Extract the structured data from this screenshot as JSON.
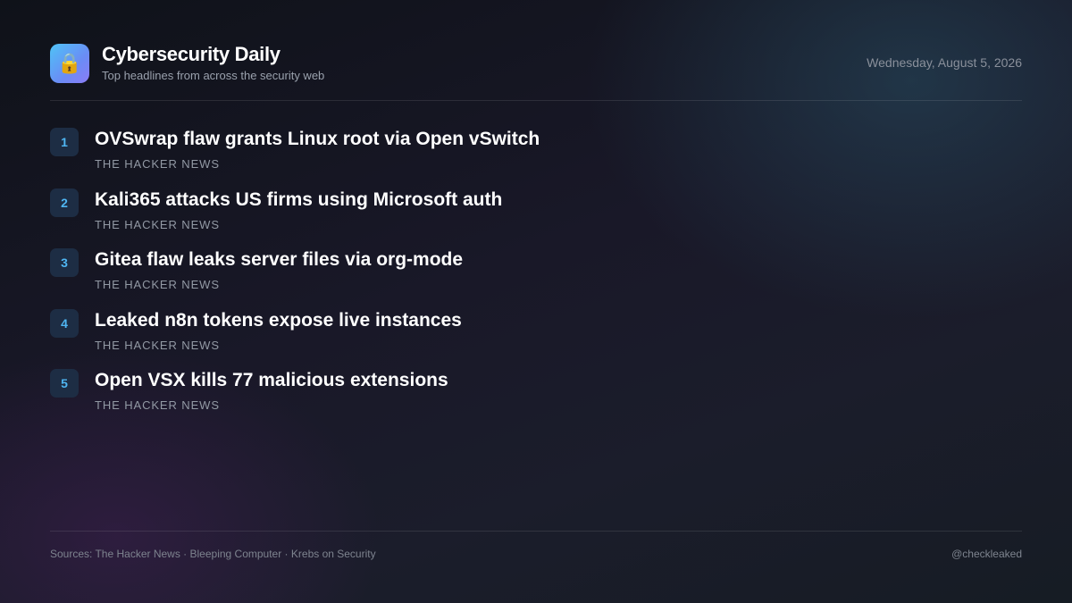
{
  "header": {
    "logo_icon": "🔒",
    "title": "Cybersecurity Daily",
    "subtitle": "Top headlines from across the security web",
    "date": "Wednesday, August 5, 2026"
  },
  "headlines": [
    {
      "rank": "1",
      "title": "OVSwrap flaw grants Linux root via Open vSwitch",
      "source": "THE HACKER NEWS"
    },
    {
      "rank": "2",
      "title": "Kali365 attacks US firms using Microsoft auth",
      "source": "THE HACKER NEWS"
    },
    {
      "rank": "3",
      "title": "Gitea flaw leaks server files via org-mode",
      "source": "THE HACKER NEWS"
    },
    {
      "rank": "4",
      "title": "Leaked n8n tokens expose live instances",
      "source": "THE HACKER NEWS"
    },
    {
      "rank": "5",
      "title": "Open VSX kills 77 malicious extensions",
      "source": "THE HACKER NEWS"
    }
  ],
  "footer": {
    "sources": "Sources: The Hacker News · Bleeping Computer · Krebs on Security",
    "handle": "@checkleaked"
  },
  "colors": {
    "accent": "#4fb6f2",
    "badge_bg": "#1d2d44",
    "muted_text": "#9299a4"
  }
}
